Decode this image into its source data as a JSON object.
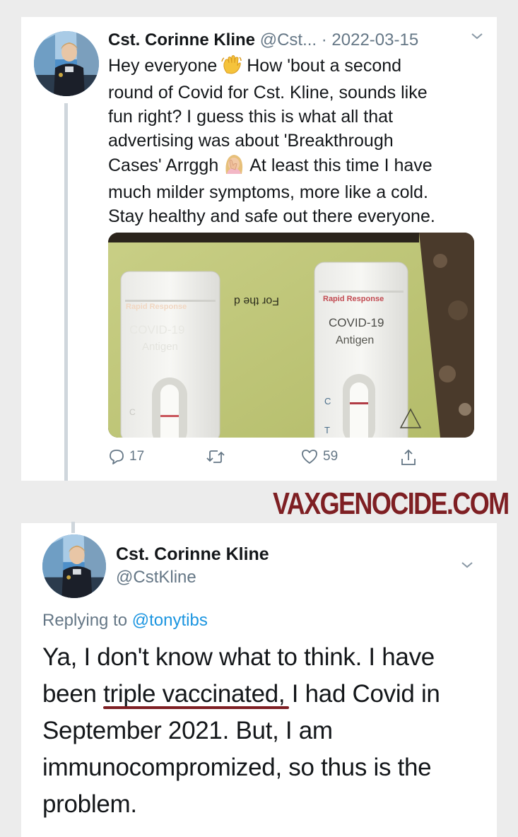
{
  "tweet1": {
    "author_name": "Cst. Corinne Kline",
    "author_handle": "@Cst...",
    "separator": " · ",
    "date": "2022-03-15",
    "text_lines": [
      [
        "Hey everyone",
        "How 'bout a second"
      ],
      [
        "round of Covid for Cst. Kline, sounds like"
      ],
      [
        "fun right? I guess this is what all that"
      ],
      [
        "advertising was about 'Breakthrough"
      ],
      [
        "Cases' Arrggh",
        "At least this time I have"
      ],
      [
        "much milder symptoms, more like a cold."
      ],
      [
        "Stay healthy and safe out there everyone."
      ]
    ],
    "media": {
      "left_test_label": "Rapid Response",
      "left_test_title": "COVID-19",
      "left_test_subtitle": "Antigen",
      "left_test_c": "C",
      "paper_text": "For the d",
      "right_test_label": "Rapid Response",
      "right_test_title": "COVID-19",
      "right_test_subtitle": "Antigen",
      "right_test_c": "C",
      "right_test_t": "T"
    },
    "actions": {
      "reply_count": "17",
      "retweet_count": "",
      "like_count": "59"
    }
  },
  "watermark": "VAXGENOCIDE.COM",
  "tweet2": {
    "author_name": "Cst. Corinne Kline",
    "author_handle": "@CstKline",
    "replying_prefix": "Replying to ",
    "replying_handle": "@tonytibs",
    "text_line1": "Ya, I don't know what to think. I have",
    "text_line2_pre": "been ",
    "text_line2_underlined": "triple vaccinated,",
    "text_line2_post": " I had Covid in",
    "text_line3": "September 2021. But, I am",
    "text_line4": "immunocompromized, so thus is the",
    "text_line5": "problem."
  },
  "icons": {
    "wave": "waving-hand-emoji",
    "facepalm": "facepalm-emoji",
    "reply": "reply-icon",
    "retweet": "retweet-icon",
    "like": "heart-icon",
    "share": "share-icon",
    "more": "chevron-down-icon"
  },
  "colors": {
    "watermark": "#7e1f23",
    "mention": "#1b95e0",
    "muted": "#657786",
    "thread_line": "#cfd6dc"
  }
}
